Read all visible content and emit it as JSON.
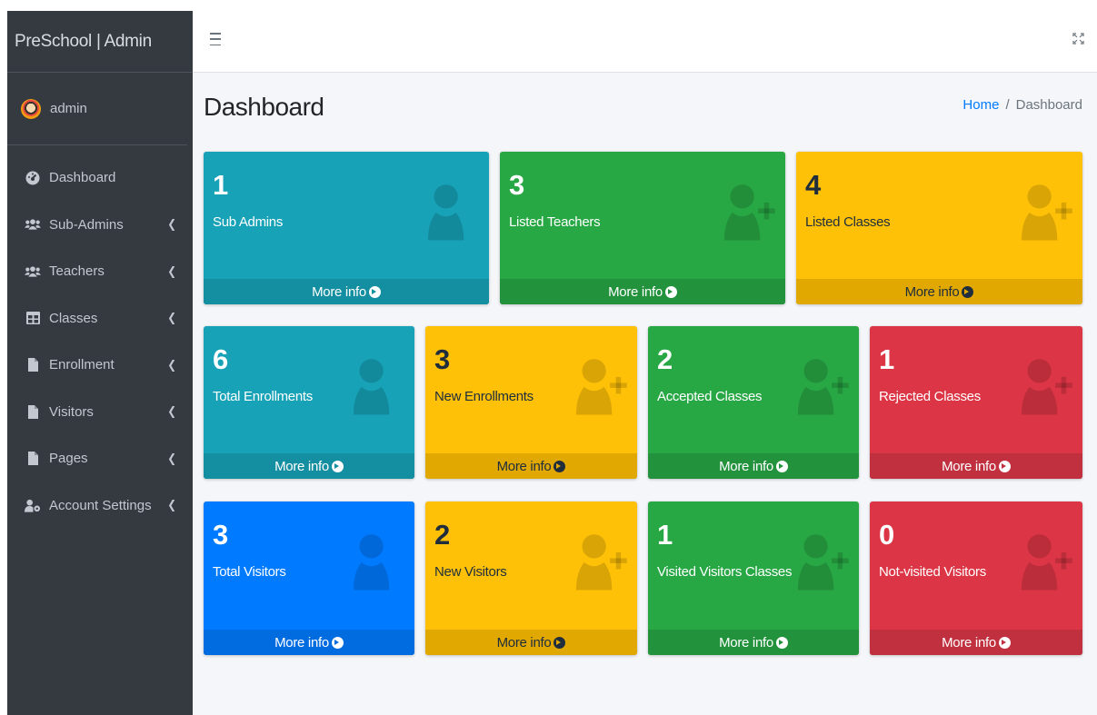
{
  "app": {
    "brand": "PreSchool | Admin"
  },
  "user": {
    "name": "admin"
  },
  "sidebar": {
    "items": [
      {
        "label": "Dashboard",
        "icon": "tachometer-icon"
      },
      {
        "label": "Sub-Admins",
        "icon": "users-icon"
      },
      {
        "label": "Teachers",
        "icon": "users-icon"
      },
      {
        "label": "Classes",
        "icon": "table-icon"
      },
      {
        "label": "Enrollment",
        "icon": "file-icon"
      },
      {
        "label": "Visitors",
        "icon": "file-icon"
      },
      {
        "label": "Pages",
        "icon": "file-icon"
      },
      {
        "label": "Account Settings",
        "icon": "user-cog-icon"
      }
    ]
  },
  "header": {
    "title": "Dashboard",
    "breadcrumb": {
      "home": "Home",
      "separator": "/",
      "current": "Dashboard"
    }
  },
  "footer_label": "More info",
  "boxes": [
    {
      "value": "1",
      "label": "Sub Admins",
      "color": "info",
      "icon": "user-icon"
    },
    {
      "value": "3",
      "label": "Listed Teachers",
      "color": "success",
      "icon": "user-plus-icon"
    },
    {
      "value": "4",
      "label": "Listed Classes",
      "color": "warning",
      "icon": "user-plus-icon"
    },
    {
      "value": "6",
      "label": "Total Enrollments",
      "color": "info",
      "icon": "user-icon"
    },
    {
      "value": "3",
      "label": "New Enrollments",
      "color": "warning",
      "icon": "user-plus-icon"
    },
    {
      "value": "2",
      "label": "Accepted Classes",
      "color": "success",
      "icon": "user-plus-icon"
    },
    {
      "value": "1",
      "label": "Rejected Classes",
      "color": "danger",
      "icon": "user-plus-icon"
    },
    {
      "value": "3",
      "label": "Total Visitors",
      "color": "primary",
      "icon": "user-icon"
    },
    {
      "value": "2",
      "label": "New Visitors",
      "color": "warning",
      "icon": "user-plus-icon"
    },
    {
      "value": "1",
      "label": "Visited Visitors Classes",
      "color": "success",
      "icon": "user-plus-icon"
    },
    {
      "value": "0",
      "label": "Not-visited Visitors",
      "color": "danger",
      "icon": "user-plus-icon"
    }
  ],
  "colors": {
    "info": "#17a2b8",
    "success": "#28a745",
    "warning": "#ffc107",
    "danger": "#dc3545",
    "primary": "#007bff",
    "sidebar": "#343a40"
  }
}
